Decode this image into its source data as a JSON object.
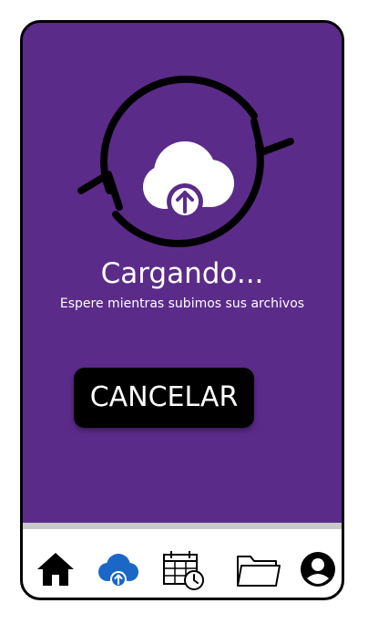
{
  "status": {
    "title": "Cargando...",
    "subtitle": "Espere mientras subimos sus archivos"
  },
  "actions": {
    "cancel_label": "CANCELAR"
  },
  "colors": {
    "background": "#5b2b8a",
    "button": "#000000",
    "nav_active": "#1a67c8",
    "nav_inactive": "#000000"
  },
  "nav": {
    "items": [
      {
        "icon": "home-icon",
        "active": false
      },
      {
        "icon": "cloud-upload-icon",
        "active": true
      },
      {
        "icon": "calendar-clock-icon",
        "active": false
      },
      {
        "icon": "folder-icon",
        "active": false
      },
      {
        "icon": "account-icon",
        "active": false
      }
    ]
  }
}
